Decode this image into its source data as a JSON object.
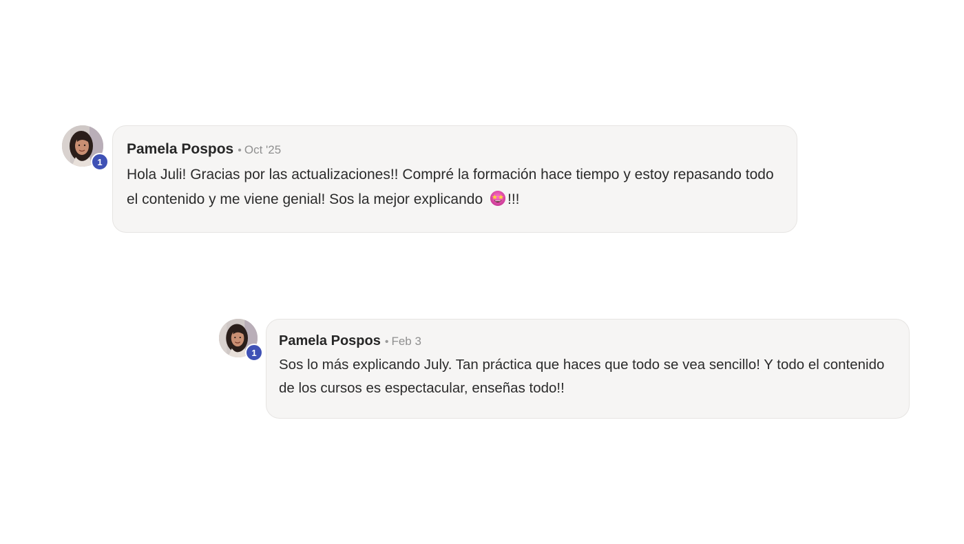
{
  "thread": {
    "comments": [
      {
        "author": "Pamela Pospos",
        "separator": "•",
        "date": "Oct '25",
        "level": "1",
        "text_before_emoji": "Hola Juli! Gracias por las actualizaciones!! Compré la formación hace tiempo y estoy repasando todo el contenido y me viene genial! Sos la mejor explicando ",
        "emoji": "star-struck-emoji",
        "text_after_emoji": "!!!",
        "avatar_icon": "user-photo-avatar"
      },
      {
        "author": "Pamela Pospos",
        "separator": "•",
        "date": "Feb 3",
        "level": "1",
        "text": "Sos lo más explicando July. Tan práctica que haces que todo se vea sencillo! Y todo el contenido de los cursos es espectacular, enseñas todo!!",
        "avatar_icon": "user-photo-avatar"
      }
    ]
  },
  "colors": {
    "badge": "#3f51b5",
    "bubble_bg": "#f6f5f4",
    "bubble_border": "#e6e4e2",
    "meta_text": "#8f8f8f"
  }
}
